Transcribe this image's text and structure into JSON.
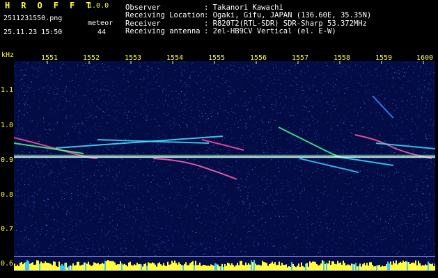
{
  "app": {
    "name": "H R O F F T",
    "version": "1.0.0"
  },
  "file": {
    "filename": "2511231550.png",
    "datetime": "25.11.23 15:50"
  },
  "meteor": {
    "label": "meteor",
    "count": "44"
  },
  "station": {
    "fields": [
      {
        "label": "Observer",
        "value": ": Takanori Kawachi"
      },
      {
        "label": "Receiving Location",
        "value": ": Ogaki, Gifu, JAPAN (136.60E, 35.35N)"
      },
      {
        "label": "Receiver",
        "value": ": R820T2(RTL-SDR) SDR-Sharp 53.372MHz"
      },
      {
        "label": "Receiving antenna",
        "value": ": 2el-HB9CV Vertical (el. E-W)"
      }
    ]
  },
  "axis": {
    "unit": "kHz",
    "minutes": [
      "1551",
      "1552",
      "1553",
      "1554",
      "1555",
      "1556",
      "1557",
      "1558",
      "1559",
      "1600"
    ],
    "freq_ticks": [
      "1.1",
      "1.0",
      "0.9",
      "0.8",
      "0.7",
      "0.6"
    ],
    "freq_values": [
      1.1,
      1.0,
      0.9,
      0.8,
      0.7,
      0.6
    ]
  },
  "colors": {
    "label": "#ffff3c",
    "background": "#040c46",
    "carrier": "#ffffff",
    "level": "#ffff3c",
    "level_low": "#3cc8ff"
  }
}
